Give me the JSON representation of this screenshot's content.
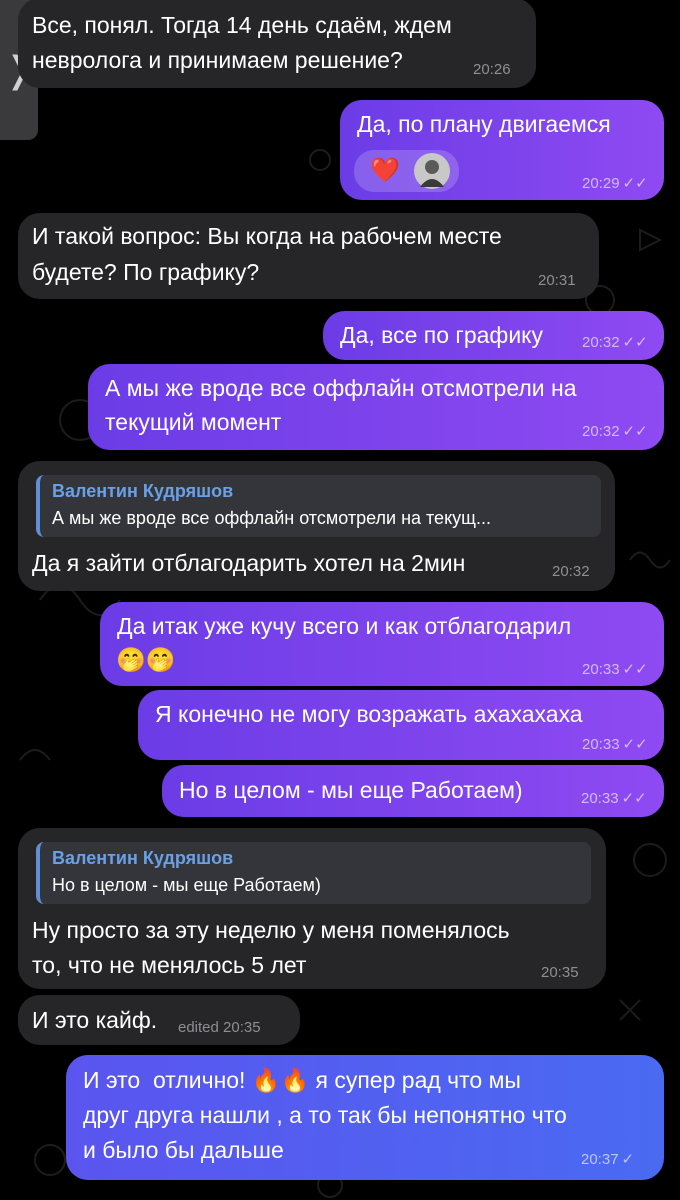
{
  "nav": {
    "back_icon": "chevron-right-icon",
    "back_glyph": "❭"
  },
  "colors": {
    "incoming": "#262628",
    "outgoing": "#8f4af2",
    "outgoing_last": "#4a6af2",
    "reply_name": "#6aa0e6"
  },
  "messages": [
    {
      "dir": "in",
      "lines": [
        "Все, понял. Тогда 14 день сдаём, ждем",
        "невролога и принимаем решение?"
      ],
      "time": "20:26"
    },
    {
      "dir": "out",
      "lines": [
        "Да, по плану двигаемся"
      ],
      "reaction": "❤️",
      "reaction_icon": "heart-icon",
      "time": "20:29",
      "checks": "✓✓"
    },
    {
      "dir": "in",
      "lines": [
        "И такой вопрос: Вы когда на рабочем месте",
        "будете? По графику?"
      ],
      "time": "20:31"
    },
    {
      "dir": "out",
      "lines": [
        "Да, все по графику"
      ],
      "time": "20:32",
      "checks": "✓✓"
    },
    {
      "dir": "out",
      "lines": [
        "А мы же вроде все оффлайн отсмотрели на",
        "текущий момент"
      ],
      "time": "20:32",
      "checks": "✓✓"
    },
    {
      "dir": "in",
      "reply": {
        "name": "Валентин Кудряшов",
        "text": "А мы же вроде все оффлайн отсмотрели на текущ..."
      },
      "lines": [
        "Да я зайти отблагодарить хотел на 2мин"
      ],
      "time": "20:32"
    },
    {
      "dir": "out",
      "lines": [
        "Да итак уже кучу всего и как отблагодарил"
      ],
      "emoji": "🤭🤭",
      "time": "20:33",
      "checks": "✓✓"
    },
    {
      "dir": "out",
      "lines": [
        "Я конечно не могу возражать ахахахаха"
      ],
      "time": "20:33",
      "checks": "✓✓"
    },
    {
      "dir": "out",
      "lines": [
        "Но в целом - мы еще Работаем)"
      ],
      "time": "20:33",
      "checks": "✓✓"
    },
    {
      "dir": "in",
      "reply": {
        "name": "Валентин Кудряшов",
        "text": "Но в целом - мы еще Работаем)"
      },
      "lines": [
        "Ну просто за эту неделю у меня поменялось",
        "то, что не менялось 5 лет"
      ],
      "time": "20:35"
    },
    {
      "dir": "in",
      "lines": [
        "И это кайф."
      ],
      "time": "edited 20:35"
    },
    {
      "dir": "out",
      "lines": [
        "И это  отлично! 🔥🔥 я супер рад что мы",
        "друг друга нашли , а то так бы непонятно что",
        "и было бы дальше"
      ],
      "time": "20:37",
      "checks": "✓"
    }
  ]
}
